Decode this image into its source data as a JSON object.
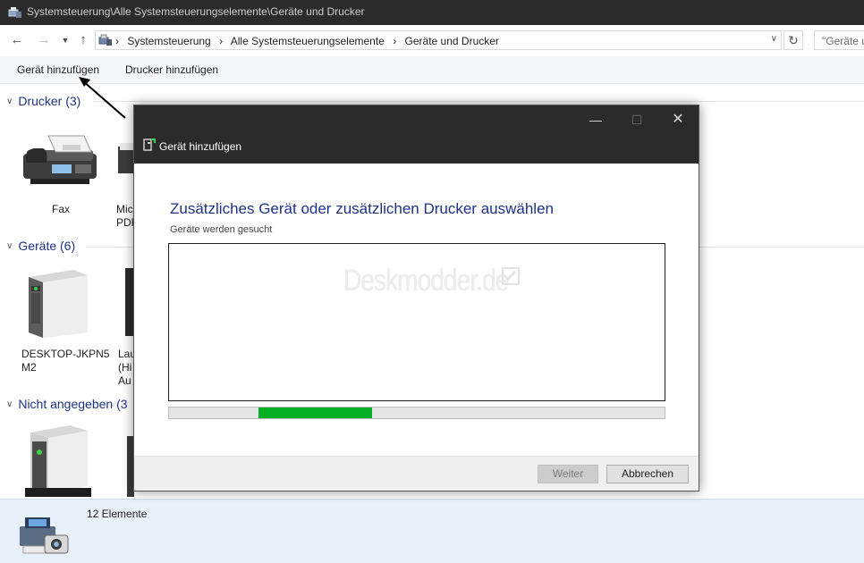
{
  "window": {
    "title": "Systemsteuerung\\Alle Systemsteuerungselemente\\Geräte und Drucker"
  },
  "addressbar": {
    "crumbs": [
      "Systemsteuerung",
      "Alle Systemsteuerungselemente",
      "Geräte und Drucker"
    ],
    "search_text": "\"Geräte u"
  },
  "commandbar": {
    "add_device": "Gerät hinzufügen",
    "add_printer": "Drucker hinzufügen"
  },
  "groups": {
    "printers": {
      "title": "Drucker (3)",
      "items": [
        "Fax",
        "Mic\nPDF"
      ]
    },
    "devices": {
      "title": "Geräte (6)",
      "items": [
        "DESKTOP-JKPN5\nM2",
        "Lau\n(Hi\nAu"
      ]
    },
    "unspecified": {
      "title": "Nicht angegeben (3"
    }
  },
  "statusbar": {
    "count": "12 Elemente"
  },
  "dialog": {
    "title": "Gerät hinzufügen",
    "heading": "Zusätzliches Gerät oder zusätzlichen Drucker auswählen",
    "status": "Geräte werden gesucht",
    "watermark": "Deskmodder.de",
    "next_label": "Weiter",
    "cancel_label": "Abbrechen",
    "progress_indicator": {
      "start_fraction": 0.18,
      "end_fraction": 0.41
    }
  },
  "colors": {
    "titlebar": "#2b2b2b",
    "group_heading": "#1e3287",
    "progress_fill": "#06b025",
    "statusbar": "#e8f0fa"
  },
  "icons": {
    "back": "arrow-left-icon",
    "forward": "arrow-right-icon",
    "recent": "chevron-down-icon",
    "up": "arrow-up-icon",
    "refresh": "refresh-icon"
  }
}
